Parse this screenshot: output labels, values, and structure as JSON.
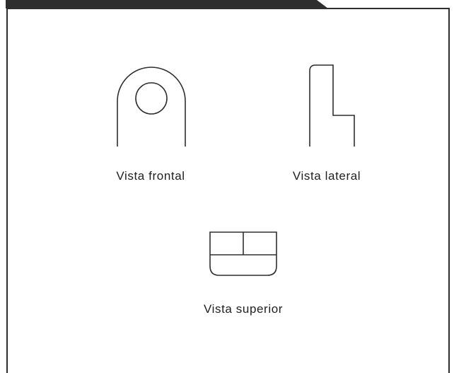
{
  "views": {
    "front_label": "Vista frontal",
    "side_label": "Vista lateral",
    "top_label": "Vista superior"
  },
  "colors": {
    "line": "#2e2e2e",
    "background": "#ffffff"
  }
}
